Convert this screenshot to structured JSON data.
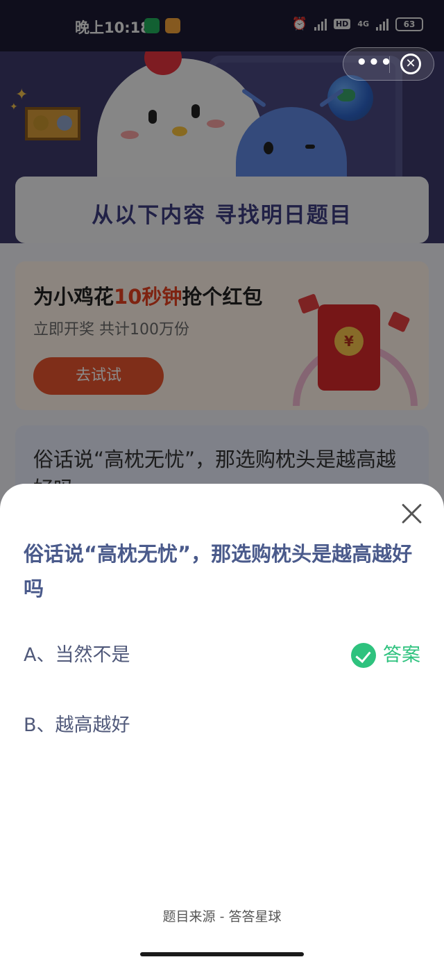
{
  "status_bar": {
    "time": "晚上10:18",
    "hd": "HD",
    "network": "4G",
    "battery": "63"
  },
  "background_page": {
    "banner_title": "从以下内容 寻找明日题目",
    "promo": {
      "title_before": "为小鸡花",
      "title_highlight": "10秒钟",
      "title_after": "抢个红包",
      "subtitle": "立即开奖 共计100万份",
      "button": "去试试",
      "coin_symbol": "¥"
    },
    "question_preview": "俗话说“高枕无忧”，那选购枕头是越高越好吗"
  },
  "capsule": {
    "more_icon": "more-dots-icon",
    "close_icon": "close-circle-icon"
  },
  "sheet": {
    "question": "俗话说“高枕无忧”，那选购枕头是越高越好吗",
    "options": [
      {
        "label": "A、当然不是",
        "is_answer": true
      },
      {
        "label": "B、越高越好",
        "is_answer": false
      }
    ],
    "answer_label": "答案",
    "source": "题目来源 - 答答星球"
  },
  "colors": {
    "accent_green": "#2ec27e",
    "question_blue": "#4a5a8b",
    "promo_red": "#e5401f"
  }
}
